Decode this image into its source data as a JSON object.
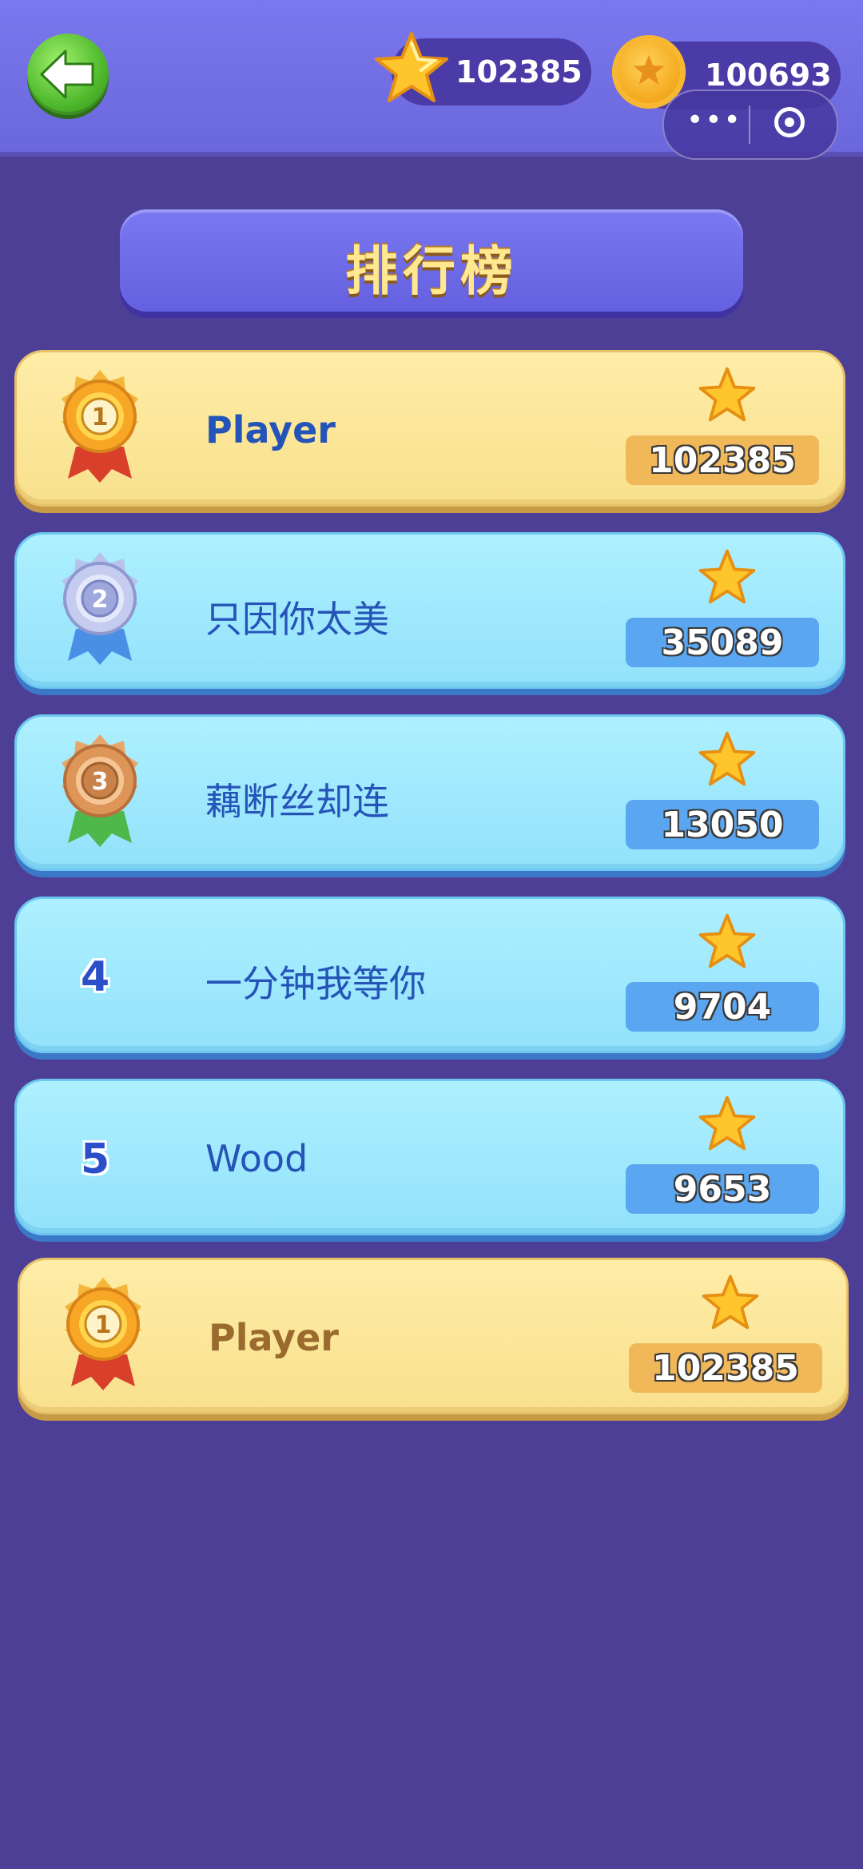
{
  "header": {
    "stars": "102385",
    "coins": "100693",
    "star_icon": "star-icon",
    "coin_icon": "coin-icon",
    "back_icon": "back-arrow-icon",
    "menu_icon": "more-dots-icon",
    "close_icon": "target-close-icon"
  },
  "title": "排行榜",
  "leaderboard": [
    {
      "rank": "1",
      "name": "Player",
      "score": "102385",
      "medal": "gold"
    },
    {
      "rank": "2",
      "name": "只因你太美",
      "score": "35089",
      "medal": "silver"
    },
    {
      "rank": "3",
      "name": "藕断丝却连",
      "score": "13050",
      "medal": "bronze"
    },
    {
      "rank": "4",
      "name": "一分钟我等你",
      "score": "9704",
      "medal": "none"
    },
    {
      "rank": "5",
      "name": "Wood",
      "score": "9653",
      "medal": "none"
    }
  ],
  "me": {
    "rank": "1",
    "name": "Player",
    "score": "102385",
    "medal": "gold"
  },
  "colors": {
    "background": "#4e3f96",
    "gold_row": "#f8e08d",
    "blue_row": "#92e2fb",
    "accent_title": "#ffe890"
  }
}
